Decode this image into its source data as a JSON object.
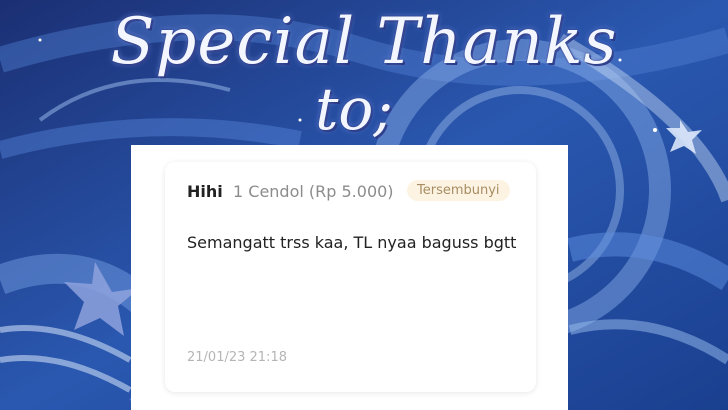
{
  "banner": {
    "line1": "Special Thanks",
    "line2": "to;"
  },
  "donation": {
    "name": "Hihi",
    "amount": "1 Cendol (Rp 5.000)",
    "badge": "Tersembunyi",
    "message": "Semangatt trss kaa, TL nyaa baguss bgtt",
    "timestamp": "21/01/23 21:18"
  },
  "colors": {
    "background": "#1c3d8a",
    "badge_text": "#a88d62",
    "badge_bg": "#fdf3e3"
  }
}
